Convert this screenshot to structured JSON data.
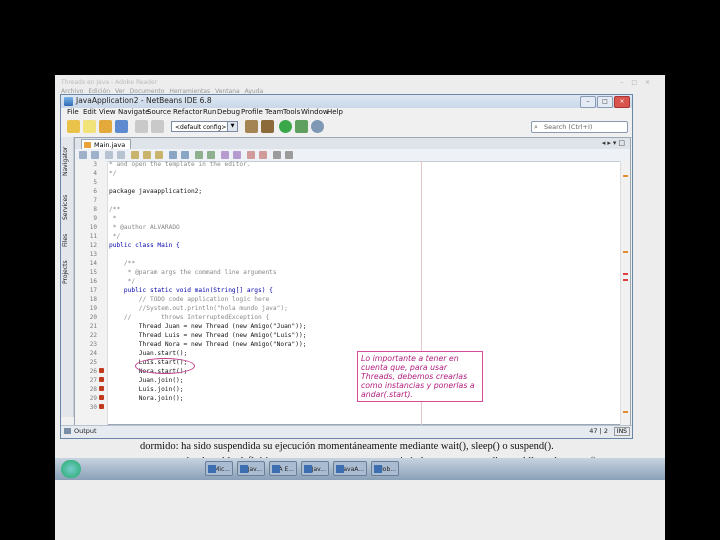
{
  "background_doc": {
    "title": "Threads en Java - Adobe Reader",
    "menu": "Archivo  Edición  Ver  Documento  Herramientas  Ventana  Ayuda",
    "window_controls": "– □ ×",
    "line1": "dormido: ha sido suspendida su ejecución momentáneamente mediante wait(), sleep() o suspend().",
    "line2": "muerto: se ha detenido definitivamente, ya sea porque se terminó el programa o mediante el llamado a stop()."
  },
  "taskbar": {
    "items": [
      "Mic...",
      "Jav...",
      "A E...",
      "Jav...",
      "JavaA...",
      "Adob..."
    ]
  },
  "ide": {
    "title": "JavaApplication2 - NetBeans IDE 6.8",
    "menu": [
      "File",
      "Edit",
      "View",
      "Navigate",
      "Source",
      "Refactor",
      "Run",
      "Debug",
      "Profile",
      "Team",
      "Tools",
      "Window",
      "Help"
    ],
    "config_select": "<default config>",
    "search_placeholder": "Search (Ctrl+I)",
    "side_tabs": [
      "Navigator",
      "Services",
      "Files",
      "Projects"
    ],
    "file_tab": "Main.java",
    "output_tab": "Output",
    "position": "47 | 2",
    "insert_mode": "INS"
  },
  "code": {
    "line_numbers": [
      "3",
      "4",
      "5",
      "6",
      "7",
      "8",
      "9",
      "10",
      "11",
      "12",
      "13",
      "14",
      "15",
      "16",
      "17",
      "18",
      "19",
      "20",
      "21",
      "22",
      "23",
      "24",
      "25",
      "26",
      "27",
      "28",
      "29",
      "30"
    ],
    "lines": [
      "* and open the template in the editor.",
      "*/",
      "",
      "package javaapplication2;",
      "",
      "/**",
      " *",
      " * @author ALVARADO",
      " */",
      "public class Main {",
      "",
      "    /**",
      "     * @param args the command line arguments",
      "     */",
      "    public static void main(String[] args) {",
      "        // TODO code application logic here",
      "        //System.out.println(\"hola mundo java\");",
      "    //        throws InterruptedException {",
      "        Thread Juan = new Thread (new Amigo(\"Juan\"));",
      "        Thread Luis = new Thread (new Amigo(\"Luis\"));",
      "        Thread Nora = new Thread (new Amigo(\"Nora\"));",
      "        Juan.start();",
      "        Luis.start();",
      "        Nora.start();",
      "        Juan.join();",
      "        Luis.join();",
      "        Nora.join();",
      ""
    ]
  },
  "annotation": {
    "text": "Lo importante a tener en cuenta que, para usar Threads, debemos crearlas como instancias y ponerlas a andar(.start)."
  }
}
